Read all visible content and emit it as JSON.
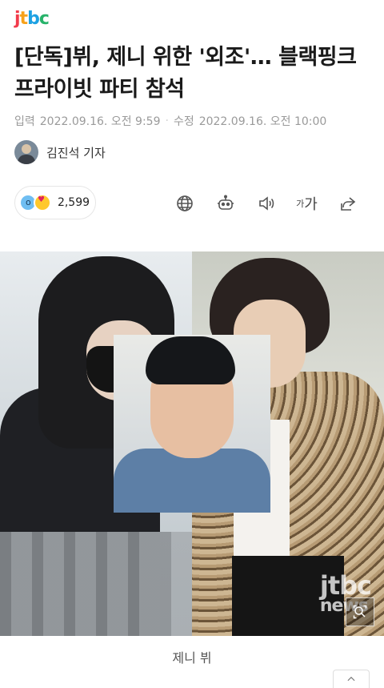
{
  "brand": {
    "logo_text": "jtbc"
  },
  "article": {
    "title": "[단독]뷔, 제니 위한 '외조'… 블랙핑크 프라이빗 파티 참석",
    "published_label": "입력",
    "published": "2022.09.16. 오전 9:59",
    "modified_label": "수정",
    "modified": "2022.09.16. 오전 10:00",
    "author": "김진석 기자"
  },
  "reactions": {
    "count": "2,599",
    "icons": [
      "wow-emoji",
      "love-eyes-emoji"
    ]
  },
  "toolbar": {
    "items": [
      {
        "name": "globe-icon"
      },
      {
        "name": "robot-icon"
      },
      {
        "name": "speaker-icon"
      },
      {
        "name": "font-size",
        "label_small": "가",
        "label": "가"
      },
      {
        "name": "share-icon"
      }
    ]
  },
  "photo": {
    "watermark_top": "jtbc",
    "watermark_bottom": "news",
    "caption": "제니 뷔"
  }
}
